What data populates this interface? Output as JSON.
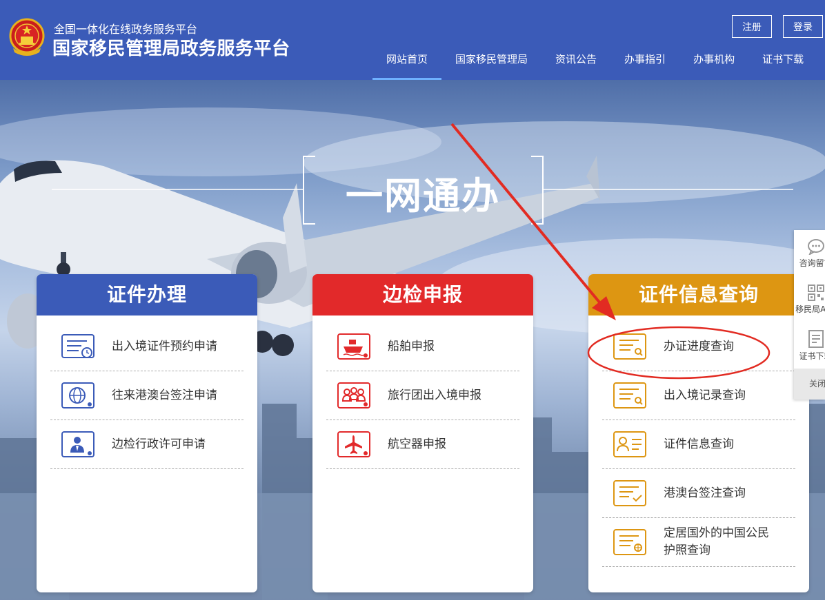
{
  "header": {
    "subtitle": "全国一体化在线政务服务平台",
    "title": "国家移民管理局政务服务平台",
    "register_label": "注册",
    "login_label": "登录"
  },
  "nav": {
    "items": [
      {
        "label": "网站首页",
        "active": true
      },
      {
        "label": "国家移民管理局"
      },
      {
        "label": "资讯公告"
      },
      {
        "label": "办事指引"
      },
      {
        "label": "办事机构"
      },
      {
        "label": "证书下载"
      }
    ]
  },
  "hero": {
    "slogan": "一网通办"
  },
  "cards": [
    {
      "title": "证件办理",
      "color": "#3b5bb8",
      "items": [
        {
          "label": "出入境证件预约申请",
          "icon": "calendar-clock-icon"
        },
        {
          "label": "往来港澳台签注申请",
          "icon": "globe-icon"
        },
        {
          "label": "边检行政许可申请",
          "icon": "officer-badge-icon"
        }
      ]
    },
    {
      "title": "边检申报",
      "color": "#e2292a",
      "items": [
        {
          "label": "船舶申报",
          "icon": "ship-icon"
        },
        {
          "label": "旅行团出入境申报",
          "icon": "tour-group-icon"
        },
        {
          "label": "航空器申报",
          "icon": "airplane-icon"
        }
      ]
    },
    {
      "title": "证件信息查询",
      "color": "#dd9612",
      "items": [
        {
          "label": "办证进度查询",
          "icon": "document-search-icon"
        },
        {
          "label": "出入境记录查询",
          "icon": "record-search-icon"
        },
        {
          "label": "证件信息查询",
          "icon": "id-card-icon"
        },
        {
          "label": "港澳台签注查询",
          "icon": "document-check-icon"
        },
        {
          "label": "定居国外的中国公民\n护照查询",
          "icon": "passport-globe-icon"
        }
      ]
    }
  ],
  "side_panel": {
    "items": [
      {
        "label": "咨询留言",
        "icon": "chat-bubble-icon"
      },
      {
        "label": "移民局APP",
        "icon": "qr-code-icon"
      },
      {
        "label": "证书下载",
        "icon": "certificate-icon"
      }
    ],
    "close_label": "关闭"
  },
  "colors": {
    "header_bg": "#3b5bb8",
    "annotation_red": "#e22b22"
  }
}
